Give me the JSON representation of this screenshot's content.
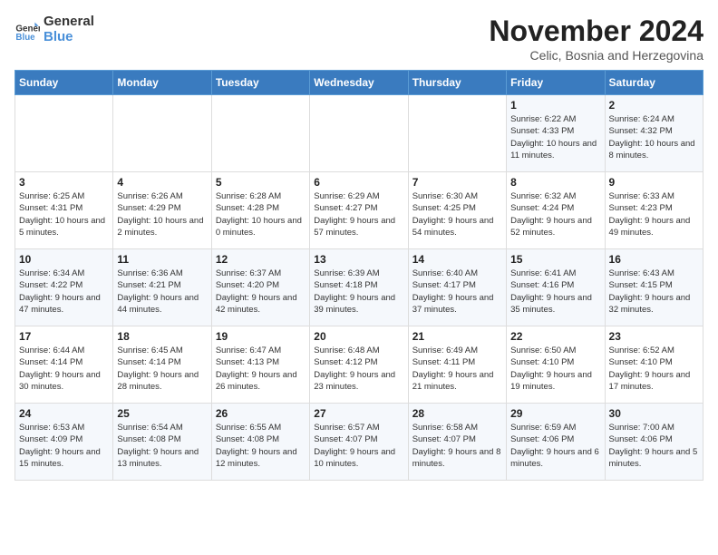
{
  "logo": {
    "text_general": "General",
    "text_blue": "Blue"
  },
  "header": {
    "month": "November 2024",
    "location": "Celic, Bosnia and Herzegovina"
  },
  "weekdays": [
    "Sunday",
    "Monday",
    "Tuesday",
    "Wednesday",
    "Thursday",
    "Friday",
    "Saturday"
  ],
  "weeks": [
    [
      {
        "day": "",
        "info": ""
      },
      {
        "day": "",
        "info": ""
      },
      {
        "day": "",
        "info": ""
      },
      {
        "day": "",
        "info": ""
      },
      {
        "day": "",
        "info": ""
      },
      {
        "day": "1",
        "info": "Sunrise: 6:22 AM\nSunset: 4:33 PM\nDaylight: 10 hours and 11 minutes."
      },
      {
        "day": "2",
        "info": "Sunrise: 6:24 AM\nSunset: 4:32 PM\nDaylight: 10 hours and 8 minutes."
      }
    ],
    [
      {
        "day": "3",
        "info": "Sunrise: 6:25 AM\nSunset: 4:31 PM\nDaylight: 10 hours and 5 minutes."
      },
      {
        "day": "4",
        "info": "Sunrise: 6:26 AM\nSunset: 4:29 PM\nDaylight: 10 hours and 2 minutes."
      },
      {
        "day": "5",
        "info": "Sunrise: 6:28 AM\nSunset: 4:28 PM\nDaylight: 10 hours and 0 minutes."
      },
      {
        "day": "6",
        "info": "Sunrise: 6:29 AM\nSunset: 4:27 PM\nDaylight: 9 hours and 57 minutes."
      },
      {
        "day": "7",
        "info": "Sunrise: 6:30 AM\nSunset: 4:25 PM\nDaylight: 9 hours and 54 minutes."
      },
      {
        "day": "8",
        "info": "Sunrise: 6:32 AM\nSunset: 4:24 PM\nDaylight: 9 hours and 52 minutes."
      },
      {
        "day": "9",
        "info": "Sunrise: 6:33 AM\nSunset: 4:23 PM\nDaylight: 9 hours and 49 minutes."
      }
    ],
    [
      {
        "day": "10",
        "info": "Sunrise: 6:34 AM\nSunset: 4:22 PM\nDaylight: 9 hours and 47 minutes."
      },
      {
        "day": "11",
        "info": "Sunrise: 6:36 AM\nSunset: 4:21 PM\nDaylight: 9 hours and 44 minutes."
      },
      {
        "day": "12",
        "info": "Sunrise: 6:37 AM\nSunset: 4:20 PM\nDaylight: 9 hours and 42 minutes."
      },
      {
        "day": "13",
        "info": "Sunrise: 6:39 AM\nSunset: 4:18 PM\nDaylight: 9 hours and 39 minutes."
      },
      {
        "day": "14",
        "info": "Sunrise: 6:40 AM\nSunset: 4:17 PM\nDaylight: 9 hours and 37 minutes."
      },
      {
        "day": "15",
        "info": "Sunrise: 6:41 AM\nSunset: 4:16 PM\nDaylight: 9 hours and 35 minutes."
      },
      {
        "day": "16",
        "info": "Sunrise: 6:43 AM\nSunset: 4:15 PM\nDaylight: 9 hours and 32 minutes."
      }
    ],
    [
      {
        "day": "17",
        "info": "Sunrise: 6:44 AM\nSunset: 4:14 PM\nDaylight: 9 hours and 30 minutes."
      },
      {
        "day": "18",
        "info": "Sunrise: 6:45 AM\nSunset: 4:14 PM\nDaylight: 9 hours and 28 minutes."
      },
      {
        "day": "19",
        "info": "Sunrise: 6:47 AM\nSunset: 4:13 PM\nDaylight: 9 hours and 26 minutes."
      },
      {
        "day": "20",
        "info": "Sunrise: 6:48 AM\nSunset: 4:12 PM\nDaylight: 9 hours and 23 minutes."
      },
      {
        "day": "21",
        "info": "Sunrise: 6:49 AM\nSunset: 4:11 PM\nDaylight: 9 hours and 21 minutes."
      },
      {
        "day": "22",
        "info": "Sunrise: 6:50 AM\nSunset: 4:10 PM\nDaylight: 9 hours and 19 minutes."
      },
      {
        "day": "23",
        "info": "Sunrise: 6:52 AM\nSunset: 4:10 PM\nDaylight: 9 hours and 17 minutes."
      }
    ],
    [
      {
        "day": "24",
        "info": "Sunrise: 6:53 AM\nSunset: 4:09 PM\nDaylight: 9 hours and 15 minutes."
      },
      {
        "day": "25",
        "info": "Sunrise: 6:54 AM\nSunset: 4:08 PM\nDaylight: 9 hours and 13 minutes."
      },
      {
        "day": "26",
        "info": "Sunrise: 6:55 AM\nSunset: 4:08 PM\nDaylight: 9 hours and 12 minutes."
      },
      {
        "day": "27",
        "info": "Sunrise: 6:57 AM\nSunset: 4:07 PM\nDaylight: 9 hours and 10 minutes."
      },
      {
        "day": "28",
        "info": "Sunrise: 6:58 AM\nSunset: 4:07 PM\nDaylight: 9 hours and 8 minutes."
      },
      {
        "day": "29",
        "info": "Sunrise: 6:59 AM\nSunset: 4:06 PM\nDaylight: 9 hours and 6 minutes."
      },
      {
        "day": "30",
        "info": "Sunrise: 7:00 AM\nSunset: 4:06 PM\nDaylight: 9 hours and 5 minutes."
      }
    ]
  ]
}
